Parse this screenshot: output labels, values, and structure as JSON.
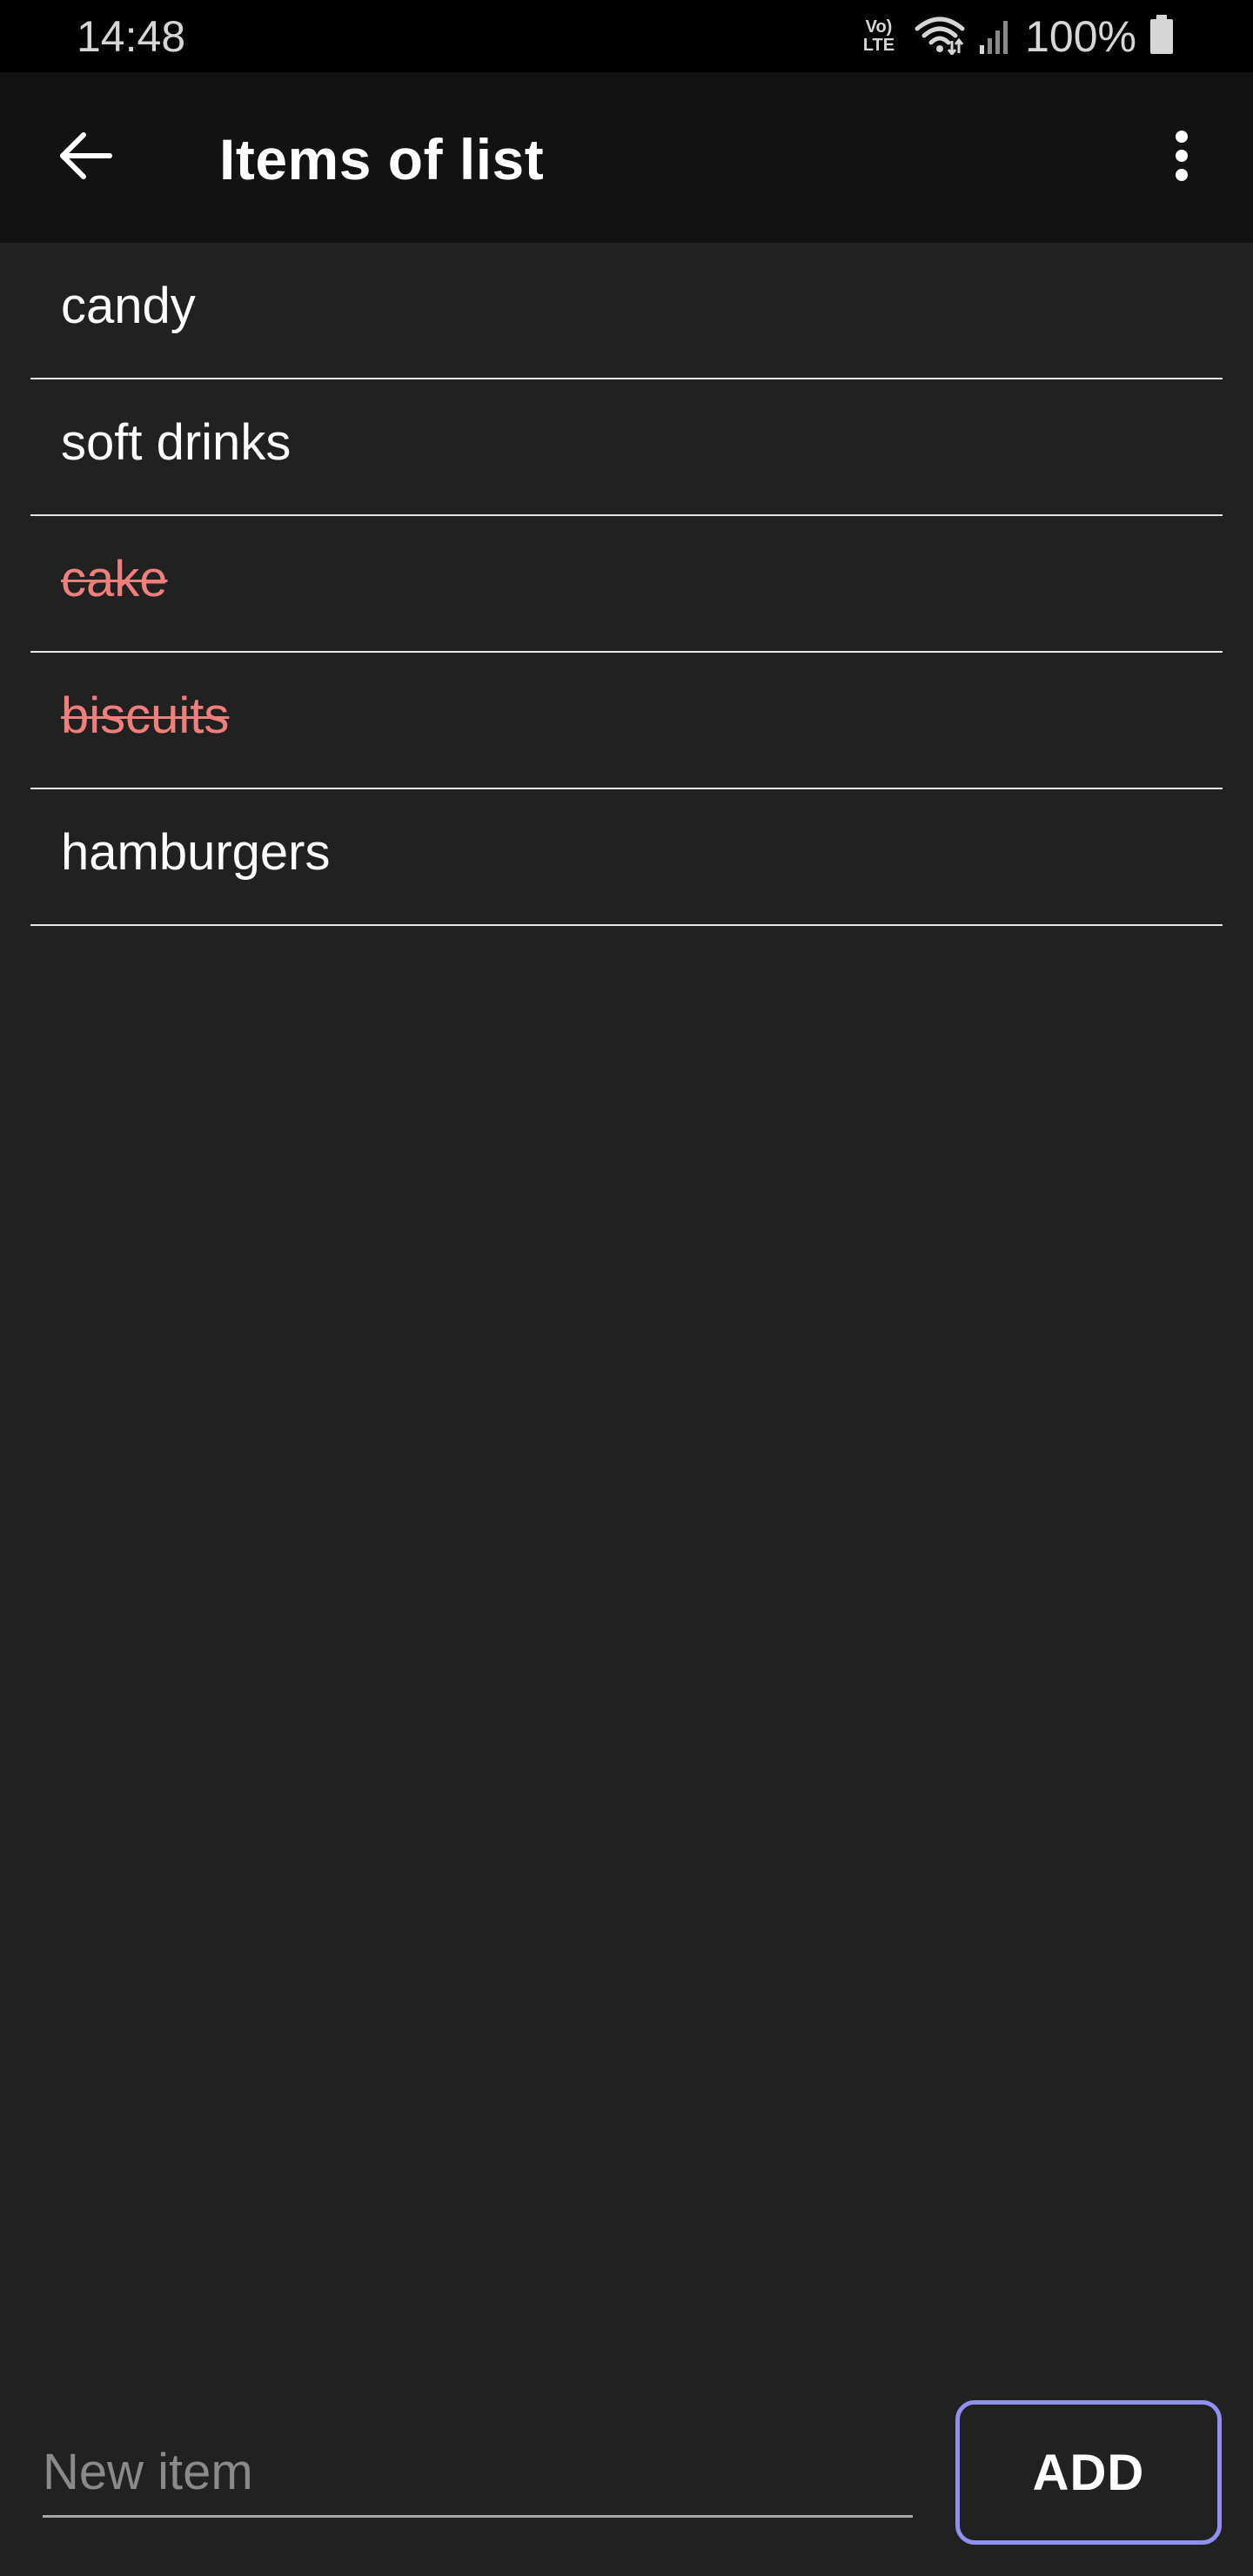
{
  "status_bar": {
    "time": "14:48",
    "volte_top": "Vo)",
    "volte_bottom": "LTE",
    "battery_percent": "100%",
    "icons": [
      "volte-icon",
      "wifi-icon",
      "signal-icon",
      "battery-icon"
    ]
  },
  "app_bar": {
    "title": "Items of list",
    "back_icon": "arrow-back-icon",
    "menu_icon": "more-vert-icon"
  },
  "items": [
    {
      "label": "candy",
      "done": false
    },
    {
      "label": "soft drinks",
      "done": false
    },
    {
      "label": "cake",
      "done": true
    },
    {
      "label": "biscuits",
      "done": true
    },
    {
      "label": "hamburgers",
      "done": false
    }
  ],
  "input": {
    "value": "",
    "placeholder": "New item"
  },
  "add_button": {
    "label": "ADD"
  },
  "colors": {
    "background": "#212121",
    "app_bar": "#121212",
    "status_bar": "#000000",
    "done_text": "#f07f7c",
    "accent_border": "#8f90f0",
    "divider": "#e6e6e6"
  }
}
